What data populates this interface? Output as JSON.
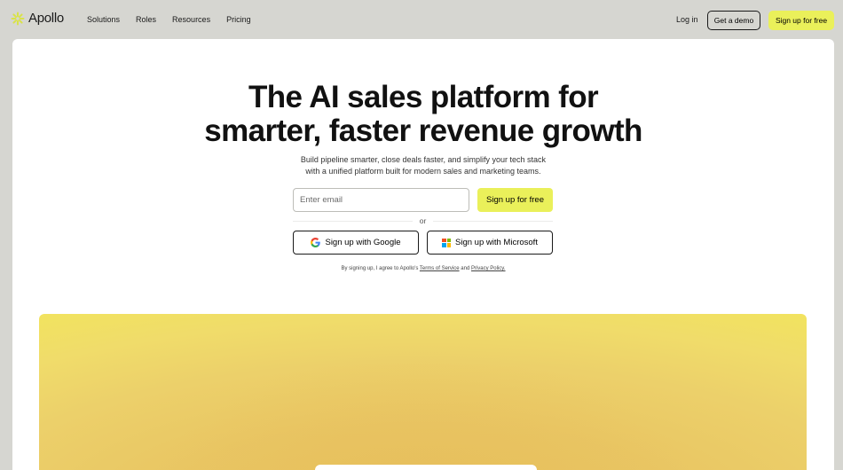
{
  "nav": {
    "logo_text": "Apollo",
    "links": [
      {
        "label": "Solutions"
      },
      {
        "label": "Roles"
      },
      {
        "label": "Resources"
      },
      {
        "label": "Pricing"
      }
    ],
    "login_label": "Log in",
    "demo_label": "Get a demo",
    "signup_label": "Sign up for free"
  },
  "hero": {
    "title_line1": "The AI sales platform for",
    "title_line2": "smarter, faster revenue growth",
    "subtitle_line1": "Build pipeline smarter, close deals faster, and simplify your tech stack",
    "subtitle_line2": "with a unified platform built for modern sales and marketing teams."
  },
  "signup_form": {
    "email_placeholder": "Enter email",
    "email_value": "",
    "submit_label": "Sign up for free",
    "or_text": "or",
    "google_label": "Sign up with Google",
    "microsoft_label": "Sign up with Microsoft",
    "terms_prefix": "By signing up, I agree to Apollo's",
    "terms_link": "Terms of Service",
    "terms_and": "and",
    "privacy_link": "Privacy Policy."
  },
  "icons": {
    "logo": "apollo-sparkle-icon",
    "google": "google-g-icon",
    "microsoft": "microsoft-logo-icon"
  },
  "colors": {
    "accent": "#eaf05a",
    "frame": "#d6d6d1",
    "banner": "#ecd06a"
  }
}
